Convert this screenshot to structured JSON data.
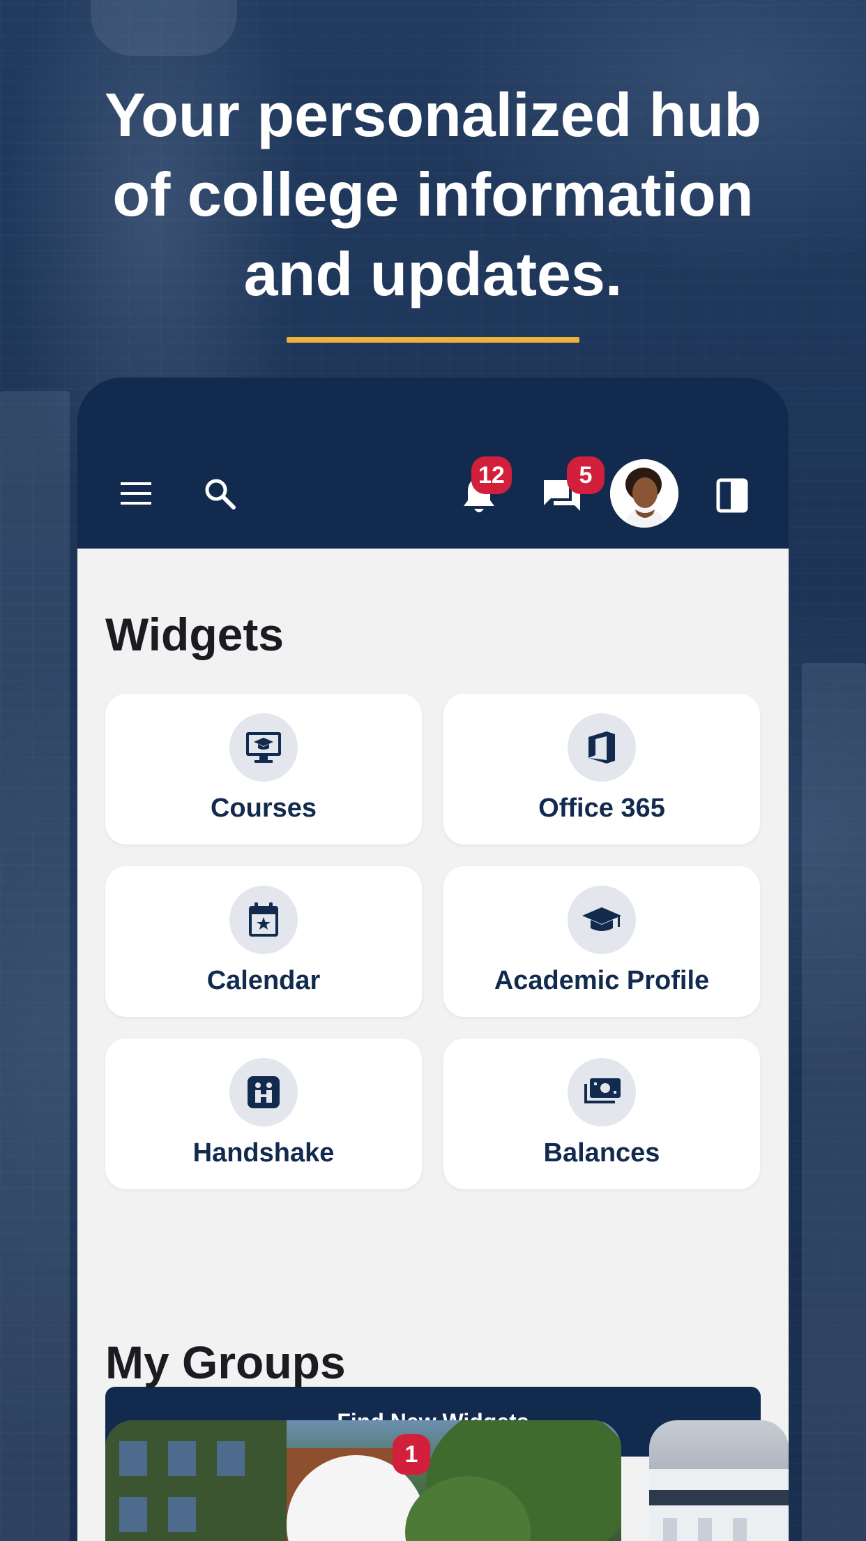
{
  "promo": {
    "headline_line1": "Your personalized hub",
    "headline_line2": "of college information",
    "headline_line3": "and updates.",
    "accent_color": "#f0b13b"
  },
  "topbar": {
    "menu_icon": "menu-icon",
    "search_icon": "search-icon",
    "notifications": {
      "icon": "bell-icon",
      "count": "12"
    },
    "messages": {
      "icon": "chat-icon",
      "count": "5"
    },
    "profile_icon": "avatar",
    "panel_icon": "side-panel-icon",
    "background_color": "#132a4f"
  },
  "widgets": {
    "title": "Widgets",
    "items": [
      {
        "label": "Courses",
        "icon": "courses-icon"
      },
      {
        "label": "Office 365",
        "icon": "office-365-icon"
      },
      {
        "label": "Calendar",
        "icon": "calendar-icon"
      },
      {
        "label": "Academic Profile",
        "icon": "graduation-cap-icon"
      },
      {
        "label": "Handshake",
        "icon": "handshake-icon"
      },
      {
        "label": "Balances",
        "icon": "money-icon"
      }
    ],
    "find_button": "Find New Widgets"
  },
  "groups": {
    "title": "My Groups",
    "first_badge": "1"
  },
  "colors": {
    "navy": "#132a4f",
    "badge_red": "#d21f3c",
    "background": "#f2f2f2"
  }
}
